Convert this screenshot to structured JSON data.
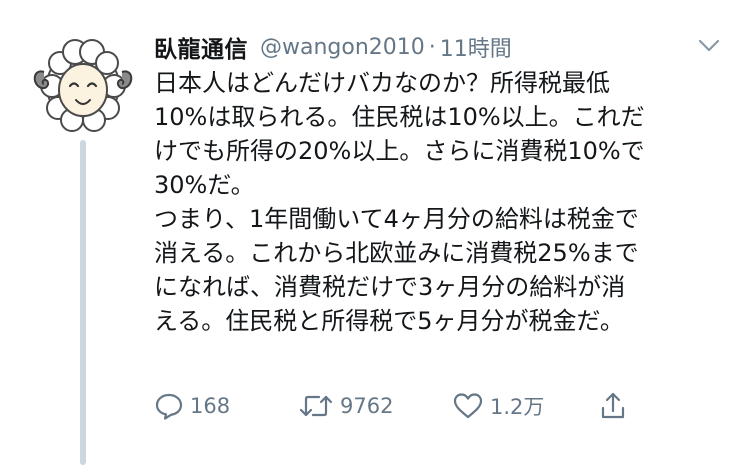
{
  "tweet": {
    "display_name": "臥龍通信",
    "handle": "@wangon2010",
    "separator": "·",
    "time": "11時間",
    "lines": [
      "日本人はどんだけバカなのか？所得税最低",
      "10%は取られる。住民税は10%以上。これだ",
      "けでも所得の20%以上。さらに消費税10%で",
      "30%だ。",
      "つまり、1年間働いて4ヶ月分の給料は税金で",
      "消える。これから北欧並みに消費税25%まで",
      "になれば、消費税だけで3ヶ月分の給料が消",
      "える。住民税と所得税で5ヶ月分が税金だ。"
    ],
    "avatar_icon": "sheep-avatar-icon",
    "menu_icon": "chevron-down-icon"
  },
  "actions": {
    "reply_count": "168",
    "retweet_count": "9762",
    "like_count": "1.2万",
    "reply_icon": "reply-icon",
    "retweet_icon": "retweet-icon",
    "like_icon": "heart-icon",
    "share_icon": "share-icon"
  },
  "colors": {
    "text": "#14171a",
    "secondary": "#657786",
    "thread_line": "#ccd6dd"
  }
}
